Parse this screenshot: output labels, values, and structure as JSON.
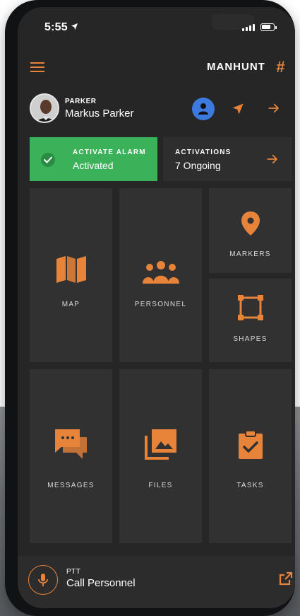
{
  "status_bar": {
    "time": "5:55",
    "location_arrow": "➤"
  },
  "header": {
    "app_name": "MANHUNT",
    "hash_symbol": "#"
  },
  "user": {
    "role": "PARKER",
    "name": "Markus Parker"
  },
  "alarm": {
    "label": "ACTIVATE ALARM",
    "status": "Activated"
  },
  "activations": {
    "label": "ACTIVATIONS",
    "value": "7 Ongoing"
  },
  "tiles": {
    "map": "MAP",
    "personnel": "PERSONNEL",
    "markers": "MARKERS",
    "shapes": "SHAPES",
    "messages": "MESSAGES",
    "files": "FILES",
    "tasks": "TASKS"
  },
  "ptt": {
    "label": "PTT",
    "value": "Call Personnel"
  },
  "colors": {
    "accent": "#e8833a",
    "alarm_green": "#3bb25a",
    "profile_blue": "#3d7ae0",
    "background": "#262626",
    "tile": "#313131"
  },
  "icons": {
    "menu": "menu-icon",
    "hash": "hash-icon",
    "profile": "person-icon",
    "navigate": "navigation-arrow-icon",
    "forward": "arrow-right-icon",
    "check": "check-circle-icon",
    "map": "map-icon",
    "personnel": "group-icon",
    "markers": "location-pin-icon",
    "shapes": "square-shape-icon",
    "messages": "chat-bubbles-icon",
    "files": "image-library-icon",
    "tasks": "clipboard-check-icon",
    "mic": "microphone-icon",
    "external": "open-in-new-icon"
  }
}
